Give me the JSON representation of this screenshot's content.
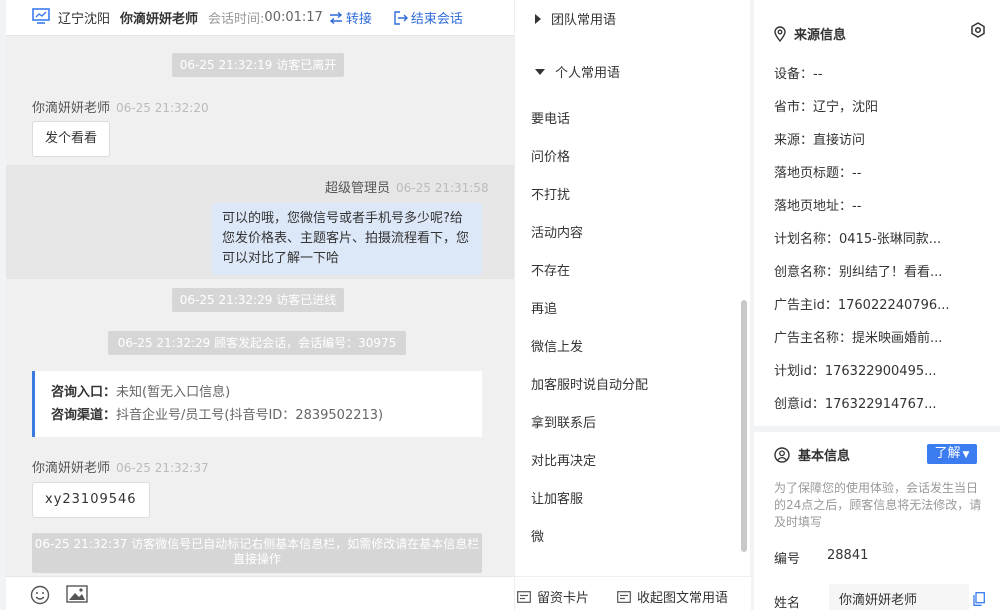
{
  "header": {
    "location": "辽宁沈阳",
    "user": "你滴妍妍老师",
    "time_label": "会话时间:",
    "time": "00:01:17",
    "transfer": "转接",
    "end": "结束会话"
  },
  "chat": {
    "sys1": "06-25 21:32:19 访客已离开",
    "msg1_sender": "你滴妍妍老师",
    "msg1_time": "06-25 21:32:20",
    "msg1_text": "发个看看",
    "msg2_sender": "超级管理员",
    "msg2_time": "06-25 21:31:58",
    "msg2_text": "可以的哦，您微信号或者手机号多少呢?给您发价格表、主题客片、拍摄流程看下，您可以对比了解一下哈",
    "sys2": "06-25 21:32:29 访客已进线",
    "sys3": "06-25 21:32:29 顾客发起会话，会话编号：30975",
    "card_entry_label": "咨询入口：",
    "card_entry_value": "未知(暂无入口信息)",
    "card_channel_label": "咨询渠道：",
    "card_channel_value": "抖音企业号/员工号(抖音号ID：2839502213)",
    "msg3_sender": "你滴妍妍老师",
    "msg3_time": "06-25 21:32:37",
    "msg3_text": "xy23109546",
    "sys4": "06-25 21:32:37 访客微信号已自动标记右侧基本信息栏，如需修改请在基本信息栏直接操作"
  },
  "phrases": {
    "team_group": "团队常用语",
    "personal_group": "个人常用语",
    "items": [
      "要电话",
      "问价格",
      "不打扰",
      "活动内容",
      "不存在",
      "再追",
      "微信上发",
      "加客服时说自动分配",
      "拿到联系后",
      "对比再决定",
      "让加客服",
      "微"
    ],
    "footer_card": "留资卡片",
    "footer_collapse": "收起图文常用语"
  },
  "source": {
    "title": "来源信息",
    "fields": [
      "设备：--",
      "省市：辽宁，沈阳",
      "来源：直接访问",
      "落地页标题：--",
      "落地页地址：--",
      "计划名称：0415-张琳同款...",
      "创意名称：别纠结了！看看...",
      "广告主id：176022240796...",
      "广告主名称：提米映画婚前...",
      "计划id：176322900495...",
      "创意id：176322914767..."
    ]
  },
  "basic": {
    "title": "基本信息",
    "learn": "了解",
    "note": "为了保障您的使用体验，会话发生当日的24点之后，顾客信息将无法修改，请及时填写",
    "id_label": "编号",
    "id_value": "28841",
    "name_label": "姓名",
    "name_value": "你滴妍妍老师"
  },
  "colors": {
    "accent": "#3b7cf0",
    "link": "#2f6bd8",
    "pill": "#d6d6d6",
    "bubble_right": "#dce8f8"
  }
}
